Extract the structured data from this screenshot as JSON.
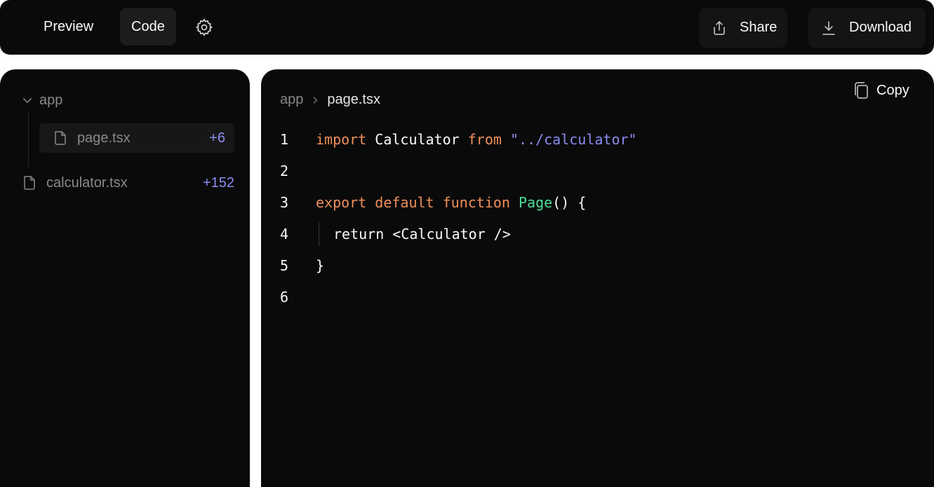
{
  "topbar": {
    "tabs": [
      {
        "label": "Preview",
        "active": false
      },
      {
        "label": "Code",
        "active": true
      }
    ],
    "settings_icon": "gear-icon",
    "share_label": "Share",
    "share_icon": "share-icon",
    "download_label": "Download",
    "download_icon": "download-icon"
  },
  "sidebar": {
    "folder": {
      "name": "app",
      "icon": "chevron-down-icon"
    },
    "files": [
      {
        "name": "page.tsx",
        "changes": "+6",
        "active": true,
        "icon": "file-icon"
      },
      {
        "name": "calculator.tsx",
        "changes": "+152",
        "active": false,
        "icon": "file-icon"
      }
    ]
  },
  "editor": {
    "breadcrumb": {
      "folder": "app",
      "separator_icon": "chevron-right-icon",
      "file": "page.tsx"
    },
    "copy_label": "Copy",
    "copy_icon": "copy-icon",
    "line_numbers": [
      "1",
      "2",
      "3",
      "4",
      "5",
      "6"
    ],
    "code": {
      "l1_kw1": "import",
      "l1_id": " Calculator ",
      "l1_kw2": "from",
      "l1_str": " \"../calculator\"",
      "l3_kw1": "export",
      "l3_kw2": " default",
      "l3_kw3": " function",
      "l3_fn": " Page",
      "l3_rest": "() {",
      "l4_text": "return <Calculator />",
      "l5_text": "}"
    }
  },
  "colors": {
    "background": "#0a0a0a",
    "keyword": "#f0905a",
    "string": "#8b8cf0",
    "function": "#4ade9a",
    "accent": "#8b8cf0"
  }
}
